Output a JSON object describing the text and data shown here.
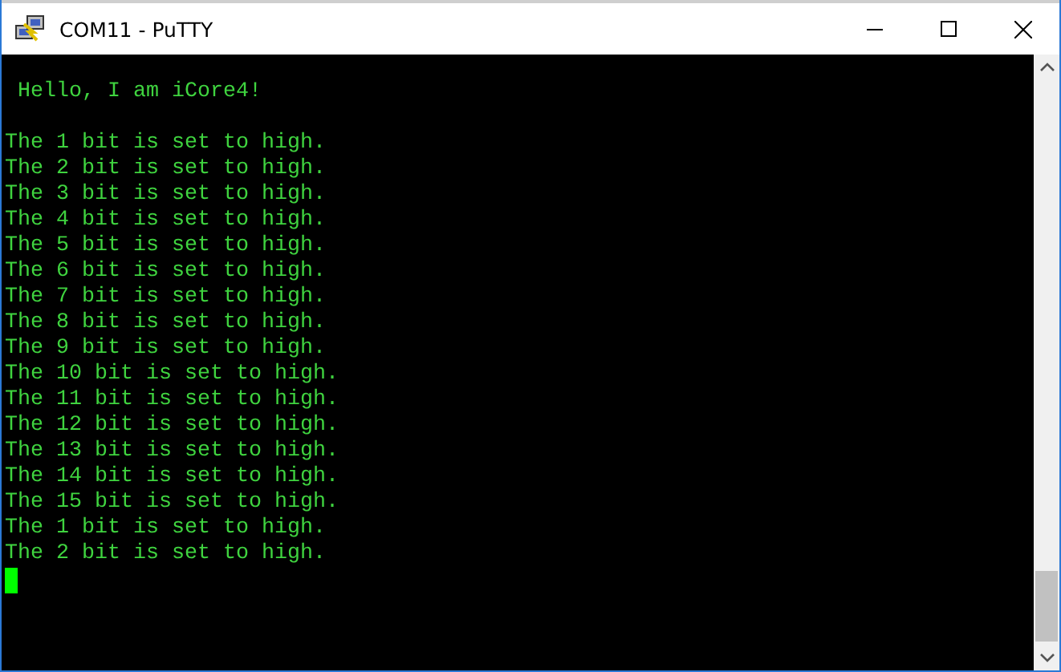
{
  "window": {
    "title": "COM11 - PuTTY"
  },
  "terminal": {
    "lines": [
      " Hello, I am iCore4!",
      "The 1 bit is set to high.",
      "The 2 bit is set to high.",
      "The 3 bit is set to high.",
      "The 4 bit is set to high.",
      "The 5 bit is set to high.",
      "The 6 bit is set to high.",
      "The 7 bit is set to high.",
      "The 8 bit is set to high.",
      "The 9 bit is set to high.",
      "The 10 bit is set to high.",
      "The 11 bit is set to high.",
      "The 12 bit is set to high.",
      "The 13 bit is set to high.",
      "The 14 bit is set to high.",
      "The 15 bit is set to high.",
      "The 1 bit is set to high.",
      "The 2 bit is set to high."
    ]
  }
}
